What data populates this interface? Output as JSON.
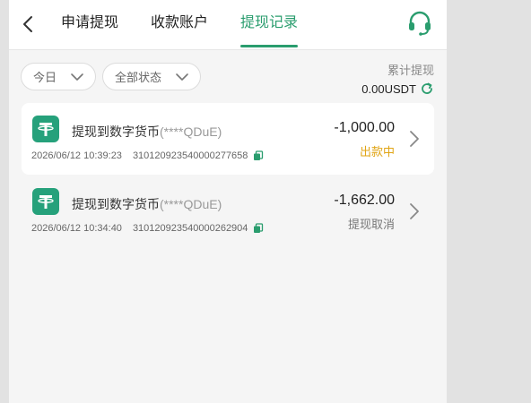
{
  "header": {
    "tabs": [
      {
        "label": "申请提现"
      },
      {
        "label": "收款账户"
      },
      {
        "label": "提现记录"
      }
    ],
    "active_tab": 2,
    "accent_color": "#2a9d6e"
  },
  "filters": {
    "date": "今日",
    "status": "全部状态"
  },
  "summary": {
    "label": "累计提现",
    "value": "0.00USDT"
  },
  "records": [
    {
      "title": "提现到数字货币",
      "account": "(****QDuE)",
      "datetime": "2026/06/12 10:39:23",
      "order_no": "310120923540000277658",
      "amount": "-1,000.00",
      "status": "出款中",
      "status_color": "#e0a414",
      "icon": "tether-icon"
    },
    {
      "title": "提现到数字货币",
      "account": "(****QDuE)",
      "datetime": "2026/06/12 10:34:40",
      "order_no": "310120923540000262904",
      "amount": "-1,662.00",
      "status": "提现取消",
      "status_color": "#777777",
      "icon": "tether-icon"
    }
  ]
}
